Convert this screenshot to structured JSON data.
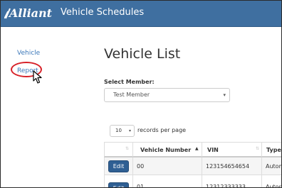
{
  "header": {
    "brand": "Alliant",
    "title": "Vehicle Schedules",
    "brand_color": "#3f6fa0"
  },
  "sidebar": {
    "items": [
      {
        "label": "Vehicle"
      },
      {
        "label": "Report"
      }
    ],
    "link_color": "#3a77b9"
  },
  "main": {
    "title": "Vehicle List",
    "select_label": "Select Member:",
    "member_select": {
      "value": "Test Member"
    },
    "page_size": {
      "value": "10",
      "suffix": "records per page"
    },
    "table": {
      "columns": [
        "",
        "Vehicle Number",
        "VIN",
        "Type"
      ],
      "rows": [
        {
          "action": "Edit",
          "vehicle_number": "00",
          "vin": "123154654654",
          "type": "Automo"
        },
        {
          "action": "Edit",
          "vehicle_number": "01",
          "vin": "12312333333",
          "type": "Automo"
        }
      ]
    }
  },
  "annotation": {
    "highlight_color": "#d72027"
  },
  "icons": {
    "caret": "▾",
    "sort": "⇅",
    "sort_asc": "▲"
  }
}
